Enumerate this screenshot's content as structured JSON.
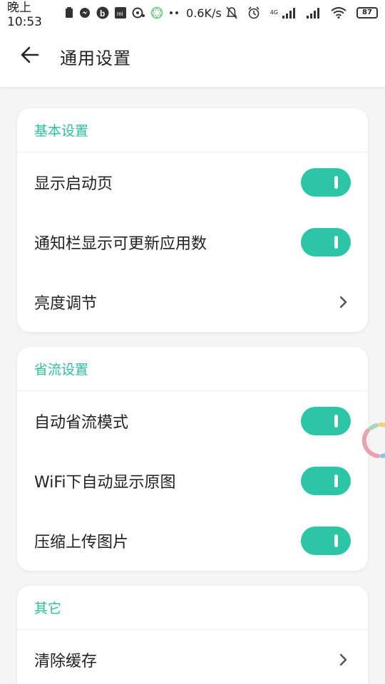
{
  "status_bar": {
    "time": "晚上10:53",
    "net_speed": "0.6K/s",
    "network_type": "4G",
    "battery": "87",
    "icons": [
      "clipboard-icon",
      "messenger-icon",
      "b-app-icon",
      "mi-icon",
      "chat-icon",
      "react-icon",
      "dots-icon",
      "mute-icon",
      "alarm-icon",
      "signal-icon",
      "signal-icon",
      "wifi-icon",
      "battery-icon"
    ]
  },
  "app_bar": {
    "back_icon": "arrow-left-icon",
    "title": "通用设置"
  },
  "sections": [
    {
      "header": "基本设置",
      "items": [
        {
          "label": "显示启动页",
          "control": "toggle",
          "on": true
        },
        {
          "label": "通知栏显示可更新应用数",
          "control": "toggle",
          "on": true
        },
        {
          "label": "亮度调节",
          "control": "chevron"
        }
      ]
    },
    {
      "header": "省流设置",
      "items": [
        {
          "label": "自动省流模式",
          "control": "toggle",
          "on": true
        },
        {
          "label": "WiFi下自动显示原图",
          "control": "toggle",
          "on": true
        },
        {
          "label": "压缩上传图片",
          "control": "toggle",
          "on": true
        }
      ]
    },
    {
      "header": "其它",
      "items": [
        {
          "label": "清除缓存",
          "control": "chevron"
        }
      ]
    }
  ],
  "colors": {
    "accent": "#2cc6a6",
    "header_text": "#2bbfa4",
    "background": "#f5f5f5",
    "card": "#ffffff"
  }
}
